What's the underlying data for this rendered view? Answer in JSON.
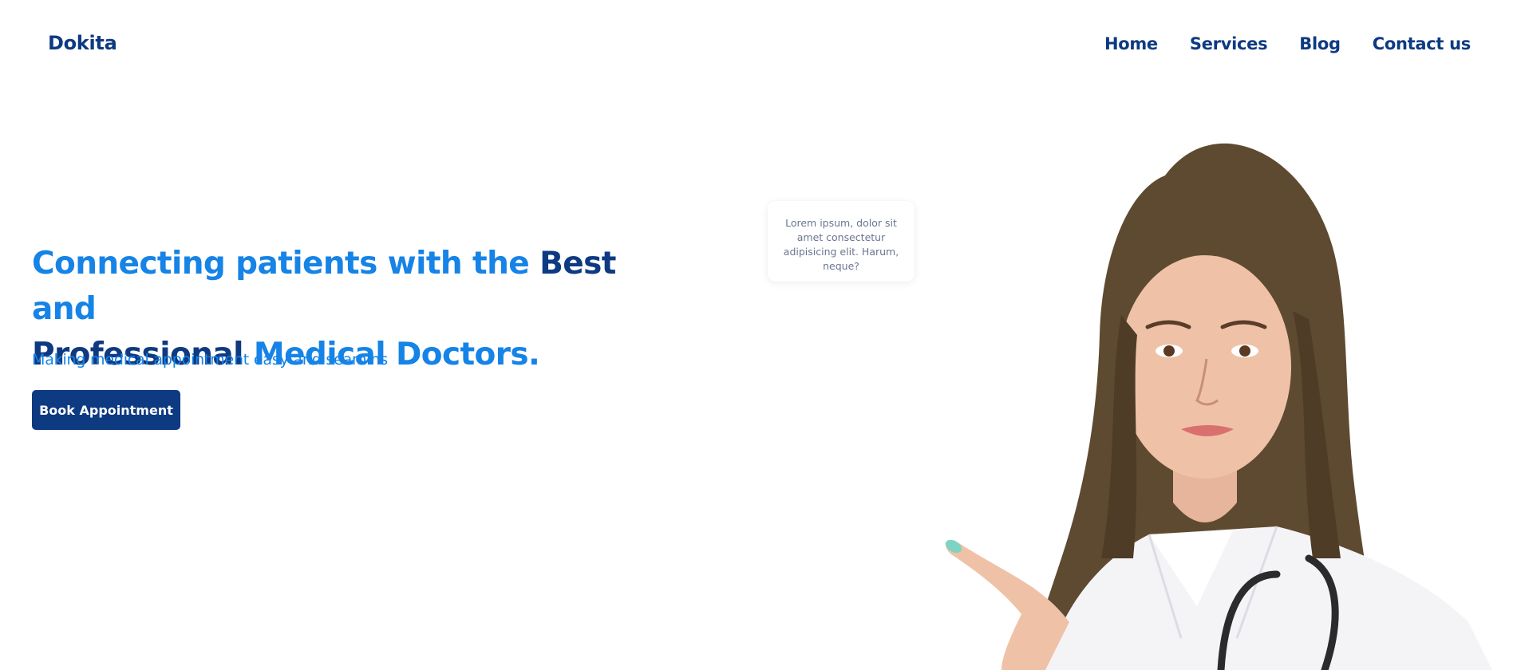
{
  "header": {
    "logo": "Dokita",
    "nav": [
      "Home",
      "Services",
      "Blog",
      "Contact us"
    ]
  },
  "hero": {
    "headline": {
      "part1": "Connecting patients with the",
      "part2": "Best",
      "part3": "and",
      "part4": "Professional",
      "part5": "Medical Doctors."
    },
    "subtitle": "Making medical appointment easy and seamins",
    "cta_label": "Book Appointment"
  },
  "card": {
    "text": "Lorem ipsum, dolor sit amet consectetur adipisicing elit. Harum, neque?"
  },
  "image": {
    "icon": "doctor-woman-pointing-image"
  },
  "colors": {
    "brand_navy": "#0e3a82",
    "brand_blue": "#1683e6",
    "card_text": "#6a7690",
    "background": "#ffffff"
  }
}
